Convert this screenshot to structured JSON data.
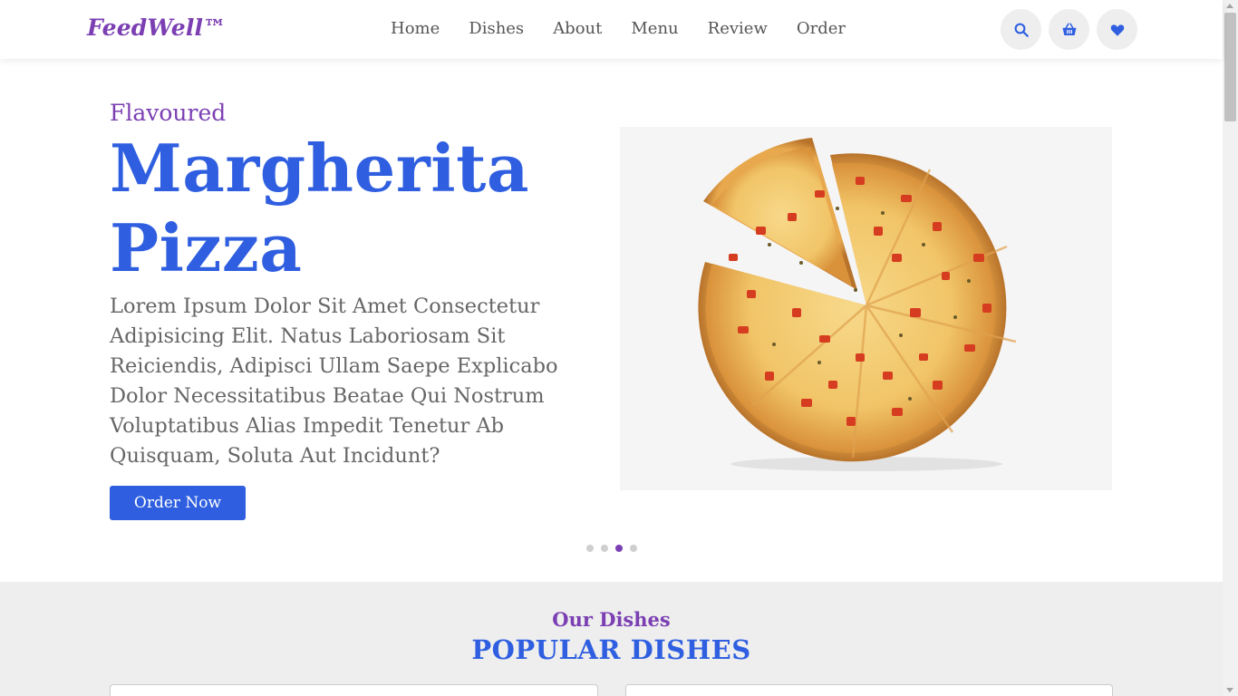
{
  "brand": {
    "logo": "FeedWell™",
    "accent": "#7b3fb3",
    "primary": "#2f5fe0"
  },
  "nav": {
    "items": [
      {
        "label": "Home"
      },
      {
        "label": "Dishes"
      },
      {
        "label": "About"
      },
      {
        "label": "Menu"
      },
      {
        "label": "Review"
      },
      {
        "label": "Order"
      }
    ]
  },
  "header_icons": [
    "search-icon",
    "basket-icon",
    "heart-icon"
  ],
  "hero": {
    "subtitle": "Flavoured",
    "title": "Margherita Pizza",
    "description": "Lorem Ipsum Dolor Sit Amet Consectetur Adipisicing Elit. Natus Laboriosam Sit Reiciendis, Adipisci Ullam Saepe Explicabo Dolor Necessitatibus Beatae Qui Nostrum Voluptatibus Alias Impedit Tenetur Ab Quisquam, Soluta Aut Incidunt?",
    "button_label": "Order Now",
    "image": "margherita-pizza",
    "slides_total": 4,
    "active_slide": 3
  },
  "dishes": {
    "subtitle": "Our Dishes",
    "title": "POPULAR DISHES"
  }
}
